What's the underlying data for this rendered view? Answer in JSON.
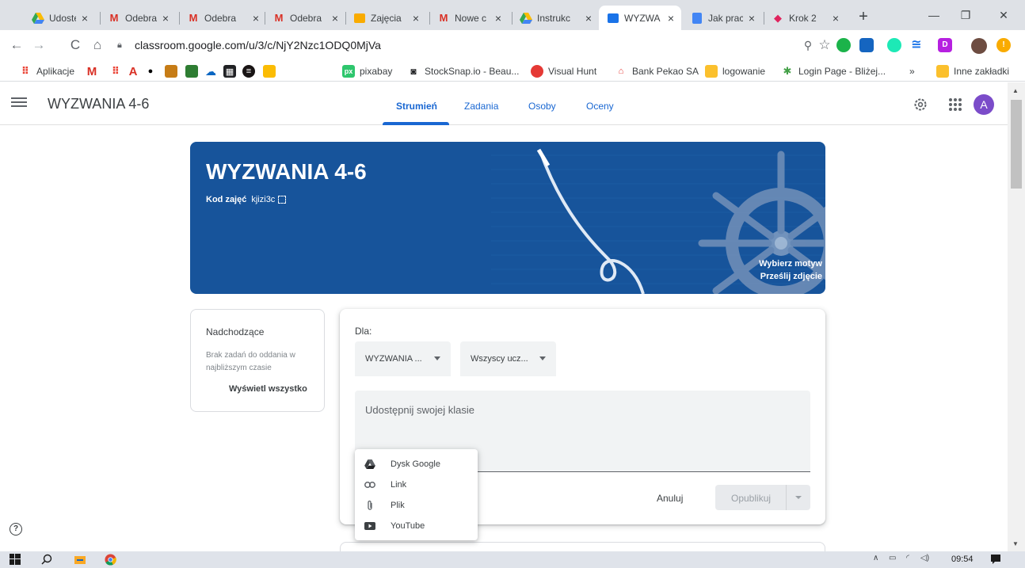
{
  "browser": {
    "tabs": [
      {
        "title": "Udostę",
        "icon": "google-drive-icon",
        "active": false
      },
      {
        "title": "Odebra",
        "icon": "gmail-icon",
        "active": false
      },
      {
        "title": "Odebra",
        "icon": "gmail-icon",
        "active": false
      },
      {
        "title": "Odebra",
        "icon": "gmail-icon",
        "active": false
      },
      {
        "title": "Zajęcia",
        "icon": "classroom-icon",
        "active": false
      },
      {
        "title": "Nowe c",
        "icon": "gmail-icon",
        "active": false
      },
      {
        "title": "Instrukc",
        "icon": "google-drive-icon",
        "active": false
      },
      {
        "title": "WYZWA",
        "icon": "classroom-icon",
        "active": true
      },
      {
        "title": "Jak prac",
        "icon": "google-docs-icon",
        "active": false
      },
      {
        "title": "Krok 2",
        "icon": "cube-icon",
        "active": false
      }
    ],
    "close_glyph": "×",
    "new_tab_glyph": "+",
    "url": "classroom.google.com/u/3/c/NjY2Nzc1ODQ0MjVa",
    "bookmarks": [
      {
        "label": "Aplikacje",
        "icon": "apps-grid-icon"
      },
      {
        "label": "",
        "icon": "gmail-icon"
      },
      {
        "label": "",
        "icon": "dots-grid-icon"
      },
      {
        "label": "",
        "icon": "acrobat-icon"
      },
      {
        "label": "",
        "icon": "apple-icon"
      },
      {
        "label": "",
        "icon": "image-bookmark-icon"
      },
      {
        "label": "",
        "icon": "green-square-icon"
      },
      {
        "label": "",
        "icon": "onedrive-icon"
      },
      {
        "label": "",
        "icon": "square-grid-icon"
      },
      {
        "label": "",
        "icon": "spotify-icon"
      },
      {
        "label": "",
        "icon": "lightbulb-icon"
      },
      {
        "label": "pixabay",
        "icon": "pixabay-icon"
      },
      {
        "label": "StockSnap.io - Beau...",
        "icon": "camera-icon"
      },
      {
        "label": "Visual Hunt",
        "icon": "visualhunt-icon"
      },
      {
        "label": "Bank Pekao SA",
        "icon": "pekao-icon"
      },
      {
        "label": "logowanie",
        "icon": "folder-icon"
      },
      {
        "label": "Login Page - Bliżej...",
        "icon": "login-page-icon"
      }
    ],
    "bookmarks_more": "»",
    "other_bookmarks": "Inne zakładki"
  },
  "classroom": {
    "class_name": "WYZWANIA 4-6",
    "tabs": [
      {
        "label": "Strumień",
        "active": true
      },
      {
        "label": "Zadania",
        "active": false
      },
      {
        "label": "Osoby",
        "active": false
      },
      {
        "label": "Oceny",
        "active": false
      }
    ],
    "avatar_letter": "A",
    "accent_color": "#1967d2",
    "banner": {
      "title": "WYZWANIA 4-6",
      "class_code_label": "Kod zajęć",
      "class_code": "kjizi3c",
      "select_theme": "Wybierz motyw",
      "upload_photo": "Prześlij zdjęcie",
      "color": "#17549b"
    },
    "upcoming": {
      "title": "Nadchodzące",
      "empty_text": "Brak zadań do oddania w najbliższym czasie",
      "view_all": "Wyświetl wszystko"
    },
    "composer": {
      "for_label": "Dla:",
      "class_select": "WYZWANIA ...",
      "students_select": "Wszyscy ucz...",
      "placeholder": "Udostępnij swojej klasie",
      "cancel": "Anuluj",
      "publish": "Opublikuj"
    },
    "attach_menu": [
      {
        "label": "Dysk Google",
        "icon": "google-drive-icon"
      },
      {
        "label": "Link",
        "icon": "link-icon"
      },
      {
        "label": "Plik",
        "icon": "paperclip-icon"
      },
      {
        "label": "YouTube",
        "icon": "youtube-icon"
      }
    ],
    "help_glyph": "?"
  },
  "taskbar": {
    "time": "09:54",
    "tray_icons": [
      "chevron-up-icon",
      "battery-icon",
      "wifi-icon",
      "volume-icon"
    ]
  }
}
